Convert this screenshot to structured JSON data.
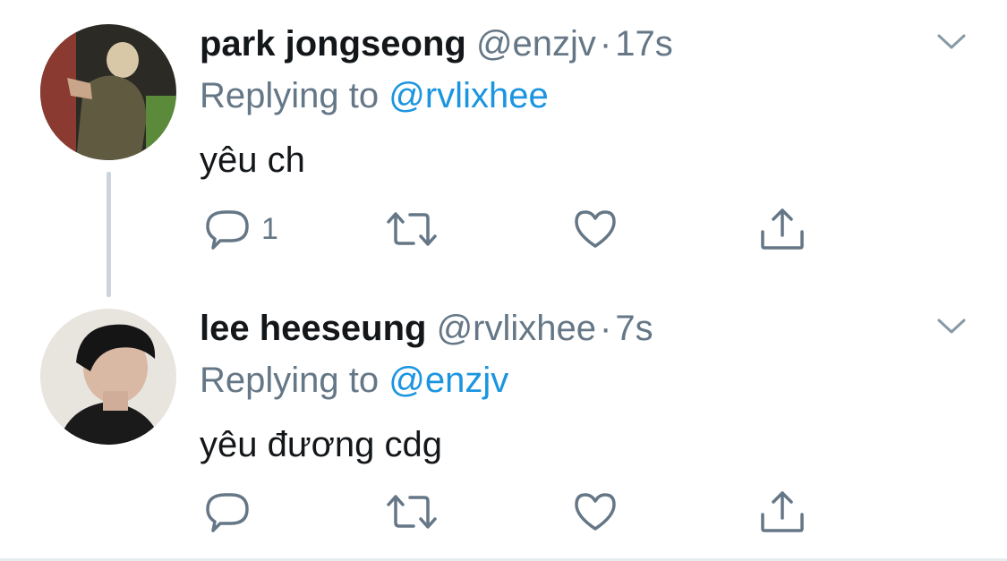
{
  "tweets": [
    {
      "name": "park jongseong",
      "handle": "@enzjv",
      "separator": "·",
      "time": "17s",
      "replying_prefix": "Replying to",
      "replying_to": "@rvlixhee",
      "text": "yêu ch",
      "reply_count": "1",
      "retweet_count": "",
      "like_count": ""
    },
    {
      "name": "lee heeseung",
      "handle": "@rvlixhee",
      "separator": "·",
      "time": "7s",
      "replying_prefix": "Replying to",
      "replying_to": "@enzjv",
      "text": "yêu đương cdg",
      "reply_count": "",
      "retweet_count": "",
      "like_count": ""
    }
  ],
  "colors": {
    "name": "#14171a",
    "secondary": "#657786",
    "link": "#1b95e0",
    "thread_line": "#cdd5dc",
    "icon": "#657786"
  },
  "icons": {
    "reply": "reply-icon",
    "retweet": "retweet-icon",
    "like": "heart-icon",
    "share": "share-icon",
    "more": "chevron-down-icon"
  }
}
